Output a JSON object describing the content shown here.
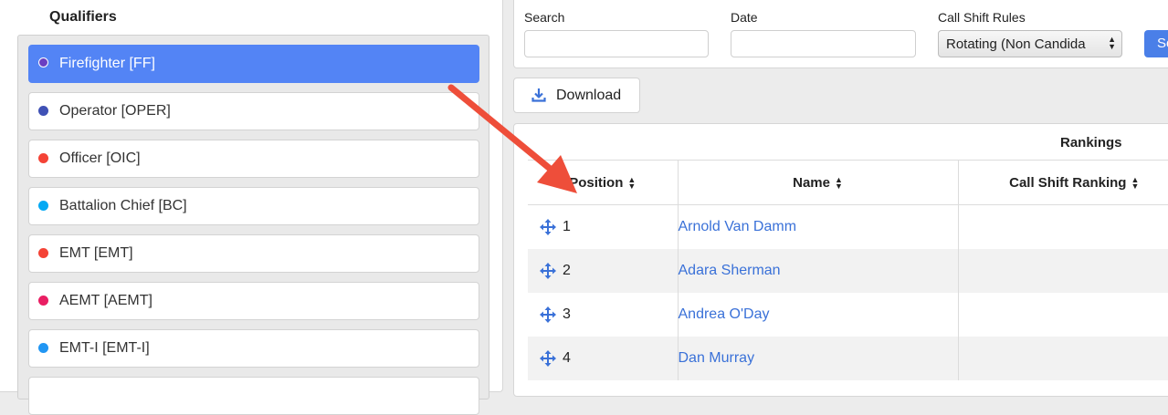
{
  "qualifiers": {
    "title": "Qualifiers",
    "items": [
      {
        "label": "Firefighter [FF]",
        "color": "#6a3fc2",
        "selected": true
      },
      {
        "label": "Operator [OPER]",
        "color": "#3f51b5",
        "selected": false
      },
      {
        "label": "Officer [OIC]",
        "color": "#f44336",
        "selected": false
      },
      {
        "label": "Battalion Chief [BC]",
        "color": "#03a9f4",
        "selected": false
      },
      {
        "label": "EMT [EMT]",
        "color": "#f44336",
        "selected": false
      },
      {
        "label": "AEMT [AEMT]",
        "color": "#e91e63",
        "selected": false
      },
      {
        "label": "EMT-I [EMT-I]",
        "color": "#2196f3",
        "selected": false
      }
    ]
  },
  "filters": {
    "search_label": "Search",
    "search_value": "",
    "date_label": "Date",
    "date_value": "",
    "rules_label": "Call Shift Rules",
    "rules_value": "Rotating (Non Candida",
    "submit_label": "Se"
  },
  "toolbar": {
    "download_label": "Download",
    "download_icon": "download-icon"
  },
  "rankings": {
    "group_header": "Rankings",
    "columns": [
      "Position",
      "Name",
      "Call Shift Ranking"
    ],
    "rows": [
      {
        "position": "1",
        "name": "Arnold Van Damm"
      },
      {
        "position": "2",
        "name": "Adara Sherman"
      },
      {
        "position": "3",
        "name": "Andrea O'Day"
      },
      {
        "position": "4",
        "name": "Dan Murray"
      }
    ]
  },
  "colors": {
    "accent": "#5384f5",
    "link": "#3a71d8",
    "annotation_arrow": "#ee4e3a"
  }
}
